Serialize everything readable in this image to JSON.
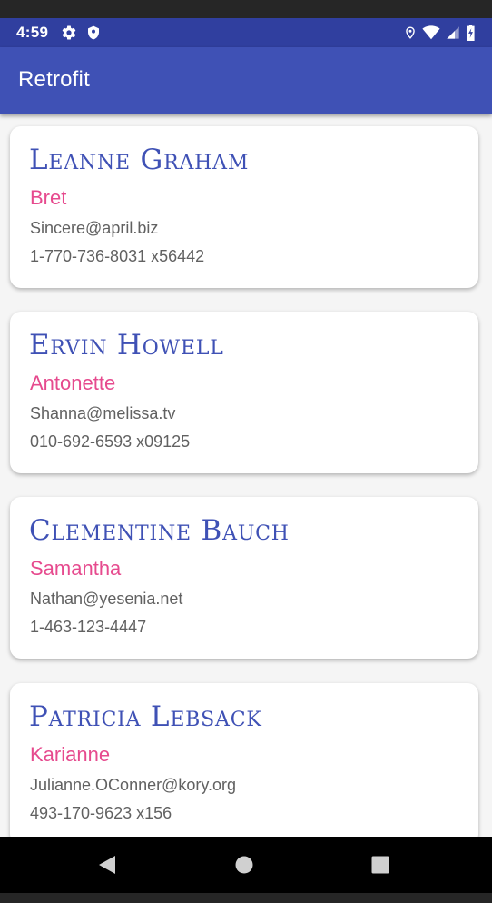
{
  "status_bar": {
    "time": "4:59",
    "left_icons": [
      "gear-icon",
      "shield-icon"
    ],
    "right_icons": [
      "location-icon",
      "wifi-icon",
      "signal-icon",
      "battery-icon"
    ],
    "background": "#303f9f"
  },
  "app_bar": {
    "title": "Retrofit",
    "background": "#3f51b5"
  },
  "users": [
    {
      "name": "Leanne Graham",
      "username": "Bret",
      "email": "Sincere@april.biz",
      "phone": "1-770-736-8031 x56442"
    },
    {
      "name": "Ervin Howell",
      "username": "Antonette",
      "email": "Shanna@melissa.tv",
      "phone": "010-692-6593 x09125"
    },
    {
      "name": "Clementine Bauch",
      "username": "Samantha",
      "email": "Nathan@yesenia.net",
      "phone": "1-463-123-4447"
    },
    {
      "name": "Patricia Lebsack",
      "username": "Karianne",
      "email": "Julianne.OConner@kory.org",
      "phone": "493-170-9623 x156"
    }
  ],
  "colors": {
    "name": "#3f51b5",
    "username": "#e64a8e",
    "detail": "#616161"
  },
  "nav_bar": {
    "buttons": [
      "back-icon",
      "home-icon",
      "recents-icon"
    ]
  }
}
